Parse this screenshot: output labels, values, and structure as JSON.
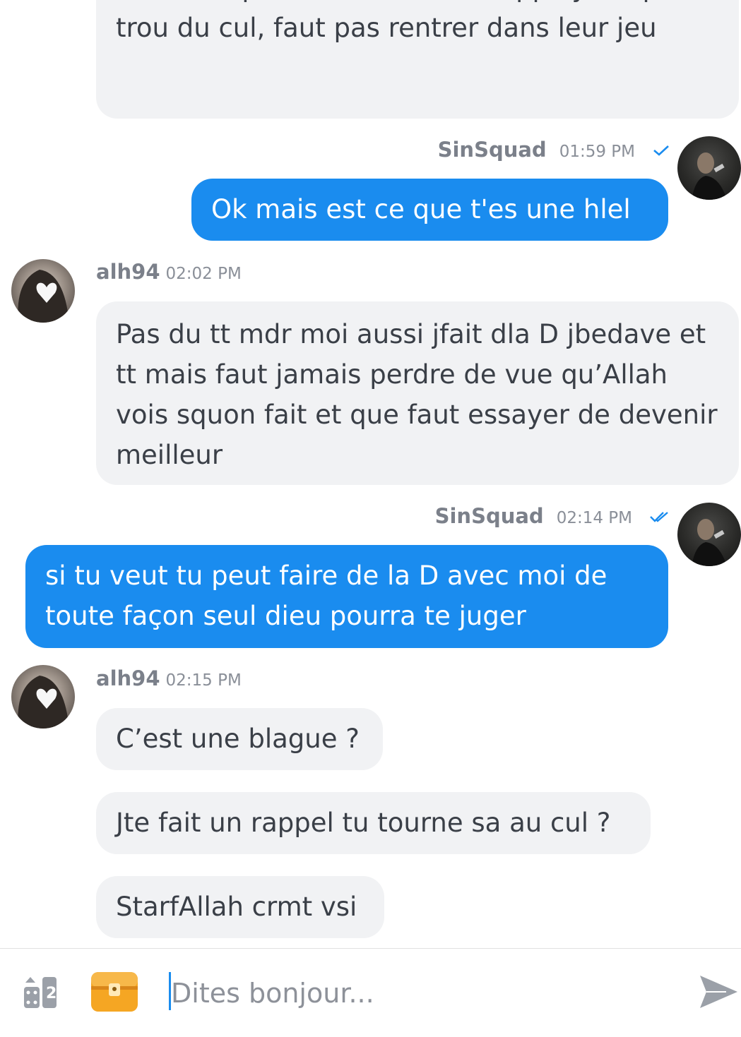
{
  "messages": [
    {
      "side": "in",
      "text": "Puis ta capter on est sur une appli ya bcp de trou du cul, faut pas rentrer dans leur jeu"
    },
    {
      "side": "out",
      "author": "SinSquad",
      "time": "01:59 PM",
      "status": "sent",
      "text": "Ok mais est ce que t'es une hlel"
    },
    {
      "side": "in",
      "author": "alh94",
      "time": "02:02 PM",
      "text": "Pas du tt mdr moi aussi jfait dla D jbedave et tt mais faut jamais perdre de vue qu’Allah vois squon fait et que faut essayer de devenir meilleur"
    },
    {
      "side": "out",
      "author": "SinSquad",
      "time": "02:14 PM",
      "status": "read",
      "text": "si tu veut tu peut faire de la D avec moi de toute façon seul dieu pourra te juger"
    },
    {
      "side": "in",
      "author": "alh94",
      "time": "02:15 PM",
      "text": "C’est une blague ?"
    },
    {
      "side": "in",
      "text": "Jte fait un rappel tu tourne sa au cul ?"
    },
    {
      "side": "in",
      "text": "StarfAllah crmt vsi"
    }
  ],
  "composer": {
    "placeholder": "Dites bonjour...",
    "left_icon": "dice-games-icon",
    "gift_icon": "treasure-chest-icon",
    "send_icon": "send-icon"
  },
  "colors": {
    "outgoing_bubble": "#1a8cef",
    "incoming_bubble": "#f1f2f4",
    "check": "#1a8cef"
  }
}
